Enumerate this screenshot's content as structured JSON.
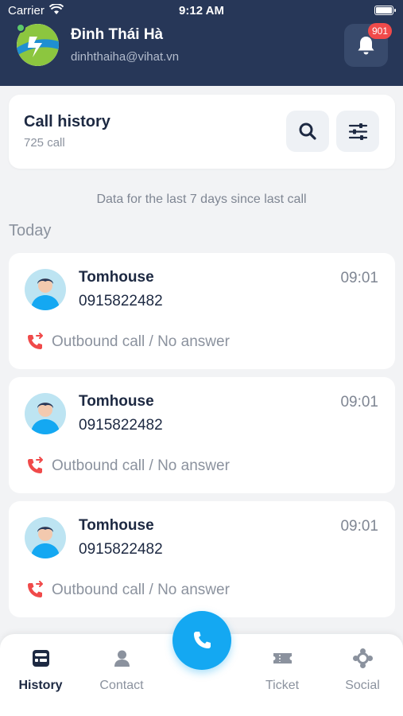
{
  "status_bar": {
    "carrier": "Carrier",
    "time": "9:12 AM"
  },
  "user": {
    "name": "Đinh Thái Hà",
    "email": "dinhthaiha@vihat.vn"
  },
  "notifications": {
    "count": "901"
  },
  "history": {
    "title": "Call history",
    "count": "725 call"
  },
  "info_text": "Data for the last 7 days since last call",
  "section": {
    "today": "Today"
  },
  "calls": [
    {
      "name": "Tomhouse",
      "phone": "0915822482",
      "time": "09:01",
      "status": "Outbound call / No answer"
    },
    {
      "name": "Tomhouse",
      "phone": "0915822482",
      "time": "09:01",
      "status": "Outbound call / No answer"
    },
    {
      "name": "Tomhouse",
      "phone": "0915822482",
      "time": "09:01",
      "status": "Outbound call / No answer"
    }
  ],
  "nav": {
    "history": "History",
    "contact": "Contact",
    "ticket": "Ticket",
    "social": "Social"
  },
  "colors": {
    "header": "#273758",
    "accent": "#14a8f2",
    "missed": "#f04a4a",
    "badge": "#f04a4a"
  },
  "icons": {
    "search": "search-icon",
    "filter": "filter-icon",
    "bell": "bell-icon",
    "call": "phone-icon",
    "outbound": "outbound-call-icon"
  }
}
